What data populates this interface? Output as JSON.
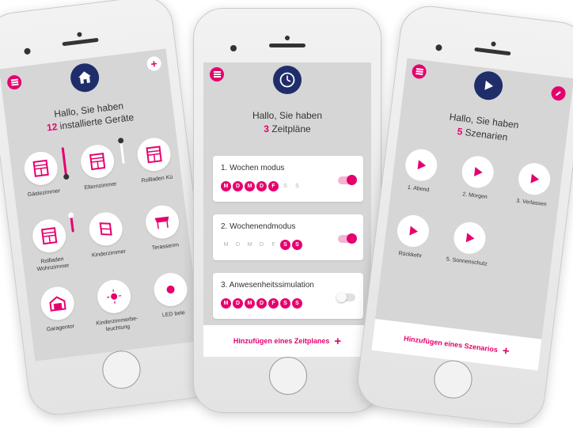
{
  "colors": {
    "accent": "#e6006e",
    "navy": "#1f2d6b"
  },
  "devices_screen": {
    "greeting_line1": "Hallo, Sie haben",
    "greeting_count": "12",
    "greeting_rest": "installierte Geräte",
    "header_icon": "home-icon",
    "add_icon": "plus-icon",
    "devices": [
      {
        "label": "Gästezimmer",
        "icon": "blind-icon",
        "slider_level": 0.9
      },
      {
        "label": "Elternzimmer",
        "icon": "blind-icon",
        "slider_level": 0.1
      },
      {
        "label": "Rollladen Kü",
        "icon": "blind-icon"
      },
      {
        "label": "Rollladen Wohnzimmer",
        "icon": "blind-icon",
        "slider_level": 0.6
      },
      {
        "label": "Kinderzimmer",
        "icon": "window-icon"
      },
      {
        "label": "Terassenm",
        "icon": "awning-icon"
      },
      {
        "label": "Garagentor",
        "icon": "garage-icon"
      },
      {
        "label": "Kinderzimmerbe-leuchtung",
        "icon": "lamp-icon"
      },
      {
        "label": "LED bele",
        "icon": "lamp-icon"
      }
    ]
  },
  "schedules_screen": {
    "greeting_line1": "Hallo, Sie haben",
    "greeting_count": "3",
    "greeting_rest": "Zeitpläne",
    "header_icon": "clock-icon",
    "schedules": [
      {
        "title": "1. Wochen modus",
        "enabled": true,
        "days": [
          {
            "d": "M",
            "on": true
          },
          {
            "d": "D",
            "on": true
          },
          {
            "d": "M",
            "on": true
          },
          {
            "d": "D",
            "on": true
          },
          {
            "d": "F",
            "on": true
          },
          {
            "d": "S",
            "on": false
          },
          {
            "d": "S",
            "on": false
          }
        ]
      },
      {
        "title": "2. Wochenendmodus",
        "enabled": true,
        "days": [
          {
            "d": "M",
            "on": false
          },
          {
            "d": "D",
            "on": false
          },
          {
            "d": "M",
            "on": false
          },
          {
            "d": "D",
            "on": false
          },
          {
            "d": "F",
            "on": false
          },
          {
            "d": "S",
            "on": true
          },
          {
            "d": "S",
            "on": true
          }
        ]
      },
      {
        "title": "3. Anwesenheitssimulation",
        "enabled": false,
        "days": [
          {
            "d": "M",
            "on": true
          },
          {
            "d": "D",
            "on": true
          },
          {
            "d": "M",
            "on": true
          },
          {
            "d": "D",
            "on": true
          },
          {
            "d": "F",
            "on": true
          },
          {
            "d": "S",
            "on": true
          },
          {
            "d": "S",
            "on": true
          }
        ]
      }
    ],
    "add_label": "Hinzufügen eines Zeitplanes",
    "add_icon": "+"
  },
  "scenes_screen": {
    "greeting_line1": "Hallo, Sie haben",
    "greeting_count": "5",
    "greeting_rest": "Szenarien",
    "header_icon": "play-icon",
    "edit_icon": "pencil-icon",
    "scenes": [
      {
        "label": "1. Abend"
      },
      {
        "label": "2. Morgen"
      },
      {
        "label": "3. Verlassen"
      },
      {
        "label": "Rückkehr"
      },
      {
        "label": "5. Sonnenschutz"
      }
    ],
    "add_label": "Hinzufügen eines Szenarios",
    "add_icon": "+"
  }
}
